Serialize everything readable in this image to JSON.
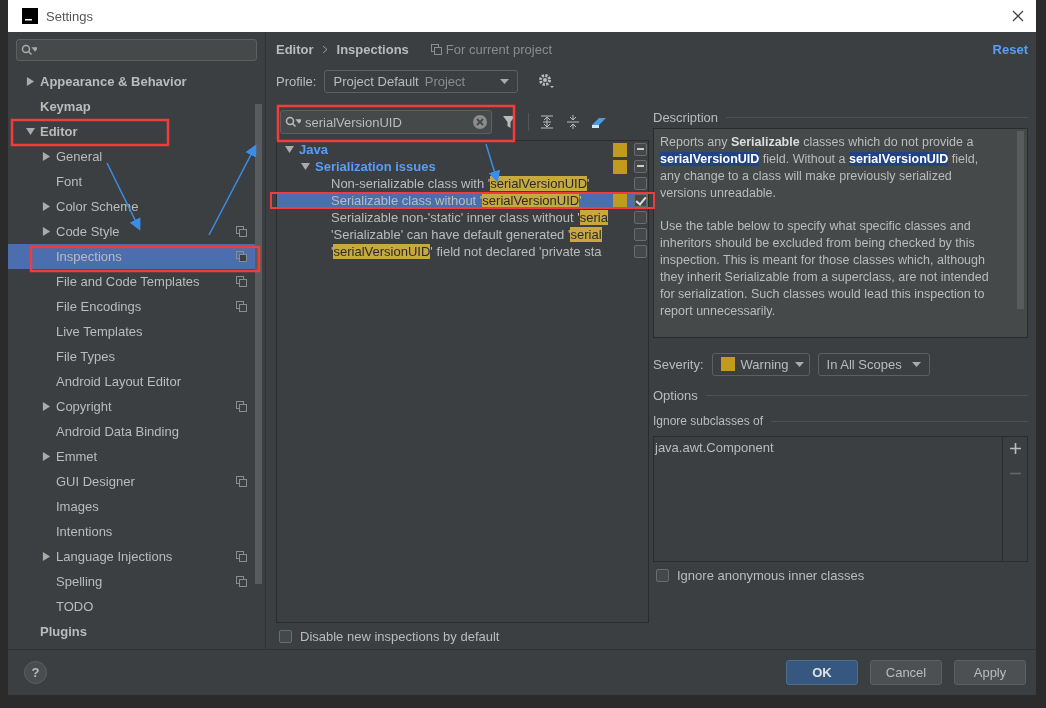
{
  "window": {
    "title": "Settings"
  },
  "sidebar": {
    "items": [
      {
        "label": "Appearance & Behavior",
        "expanded": false,
        "selected": false
      },
      {
        "label": "Keymap",
        "selected": false
      },
      {
        "label": "Editor",
        "expanded": true,
        "selected": false,
        "children": [
          {
            "label": "General",
            "expanded": false,
            "selected": false
          },
          {
            "label": "Font",
            "selected": false
          },
          {
            "label": "Color Scheme",
            "expanded": false,
            "selected": false
          },
          {
            "label": "Code Style",
            "expanded": false,
            "project_scoped": true,
            "selected": false
          },
          {
            "label": "Inspections",
            "project_scoped": true,
            "selected": true
          },
          {
            "label": "File and Code Templates",
            "project_scoped": true,
            "selected": false
          },
          {
            "label": "File Encodings",
            "project_scoped": true,
            "selected": false
          },
          {
            "label": "Live Templates",
            "selected": false
          },
          {
            "label": "File Types",
            "selected": false
          },
          {
            "label": "Android Layout Editor",
            "selected": false
          },
          {
            "label": "Copyright",
            "expanded": false,
            "project_scoped": true,
            "selected": false
          },
          {
            "label": "Android Data Binding",
            "selected": false
          },
          {
            "label": "Emmet",
            "expanded": false,
            "selected": false
          },
          {
            "label": "GUI Designer",
            "project_scoped": true,
            "selected": false
          },
          {
            "label": "Images",
            "selected": false
          },
          {
            "label": "Intentions",
            "selected": false
          },
          {
            "label": "Language Injections",
            "expanded": false,
            "project_scoped": true,
            "selected": false
          },
          {
            "label": "Spelling",
            "project_scoped": true,
            "selected": false
          },
          {
            "label": "TODO",
            "selected": false
          }
        ]
      },
      {
        "label": "Plugins",
        "selected": false
      }
    ]
  },
  "header": {
    "breadcrumb": [
      "Editor",
      "Inspections"
    ],
    "scope_note": "For current project",
    "reset": "Reset"
  },
  "profile": {
    "label": "Profile:",
    "value": "Project Default",
    "scope": "Project"
  },
  "filter": {
    "value": "serialVersionUID"
  },
  "inspections": [
    {
      "segments": [
        {
          "t": "Java"
        }
      ],
      "expanded": true,
      "color": "#c29a1d",
      "mixed": true,
      "selected": false,
      "children": [
        {
          "segments": [
            {
              "t": "Serialization issues"
            }
          ],
          "expanded": true,
          "color": "#c29a1d",
          "mixed": true,
          "selected": false,
          "children": [
            {
              "segments": [
                {
                  "t": "Non-serializable class with '"
                },
                {
                  "t": "serialVersionUID",
                  "match": true
                },
                {
                  "t": "'"
                }
              ],
              "checked": false,
              "selected": false
            },
            {
              "segments": [
                {
                  "t": "Serializable class without '"
                },
                {
                  "t": "serialVersionUID",
                  "match": true
                },
                {
                  "t": "'"
                }
              ],
              "color": "#c29a1d",
              "checked": true,
              "selected": true
            },
            {
              "segments": [
                {
                  "t": "Serializable non-'static' inner class without '"
                },
                {
                  "t": "seria",
                  "match": true
                }
              ],
              "checked": false,
              "selected": false
            },
            {
              "segments": [
                {
                  "t": "'Serializable' can have default generated '"
                },
                {
                  "t": "serial",
                  "match": true
                }
              ],
              "checked": false,
              "selected": false
            },
            {
              "segments": [
                {
                  "t": "'"
                },
                {
                  "t": "serialVersionUID",
                  "match": true
                },
                {
                  "t": "' field not declared 'private sta"
                }
              ],
              "checked": false,
              "selected": false
            }
          ]
        }
      ]
    }
  ],
  "disable_new": {
    "label": "Disable new inspections by default",
    "checked": false
  },
  "description": {
    "title": "Description",
    "paragraphs": [
      [
        {
          "t": "Reports any "
        },
        {
          "t": "Serializable",
          "kind": "bold"
        },
        {
          "t": " classes which do not provide a "
        },
        {
          "t": "serialVersionUID",
          "kind": "match"
        },
        {
          "t": " field. Without a "
        },
        {
          "t": "serialVersionUID",
          "kind": "match"
        },
        {
          "t": " field, any change to a class will make previously serialized versions unreadable."
        }
      ],
      [
        {
          "t": "Use the table below to specify what specific classes and inheritors should be excluded from being checked by this inspection. This is meant for those classes which, although they inherit Serializable from a superclass, are not intended for serialization. Such classes would lead this inspection to report unnecessarily."
        }
      ]
    ]
  },
  "severity": {
    "label": "Severity:",
    "value": "Warning",
    "color": "#c29a1d",
    "scope": "In All Scopes"
  },
  "options": {
    "title": "Options",
    "ignore_title": "Ignore subclasses of",
    "classes": [
      "java.awt.Component"
    ],
    "anonymous": {
      "label": "Ignore anonymous inner classes",
      "checked": false
    }
  },
  "help": "?",
  "buttons": [
    {
      "label": "OK",
      "kind": "primary"
    },
    {
      "label": "Cancel",
      "kind": "normal"
    },
    {
      "label": "Apply",
      "kind": "normal"
    }
  ]
}
